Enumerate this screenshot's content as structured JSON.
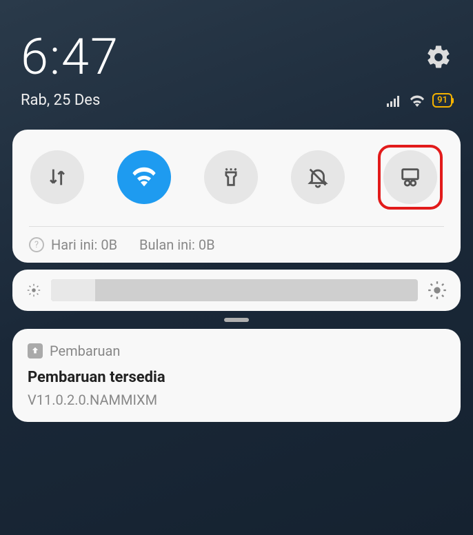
{
  "status": {
    "time": "6:47",
    "date": "Rab, 25 Des",
    "battery": "91"
  },
  "quick_settings": {
    "toggles": [
      {
        "name": "mobile-data",
        "active": false
      },
      {
        "name": "wifi",
        "active": true
      },
      {
        "name": "flashlight",
        "active": false
      },
      {
        "name": "dnd",
        "active": false
      },
      {
        "name": "screenshot",
        "active": false,
        "highlighted": true
      }
    ],
    "data_today_label": "Hari ini: 0B",
    "data_month_label": "Bulan ini: 0B"
  },
  "brightness": {
    "value_pct": 12
  },
  "notification": {
    "app_name": "Pembaruan",
    "title": "Pembaruan tersedia",
    "subtitle": "V11.0.2.0.NAMMIXM"
  }
}
